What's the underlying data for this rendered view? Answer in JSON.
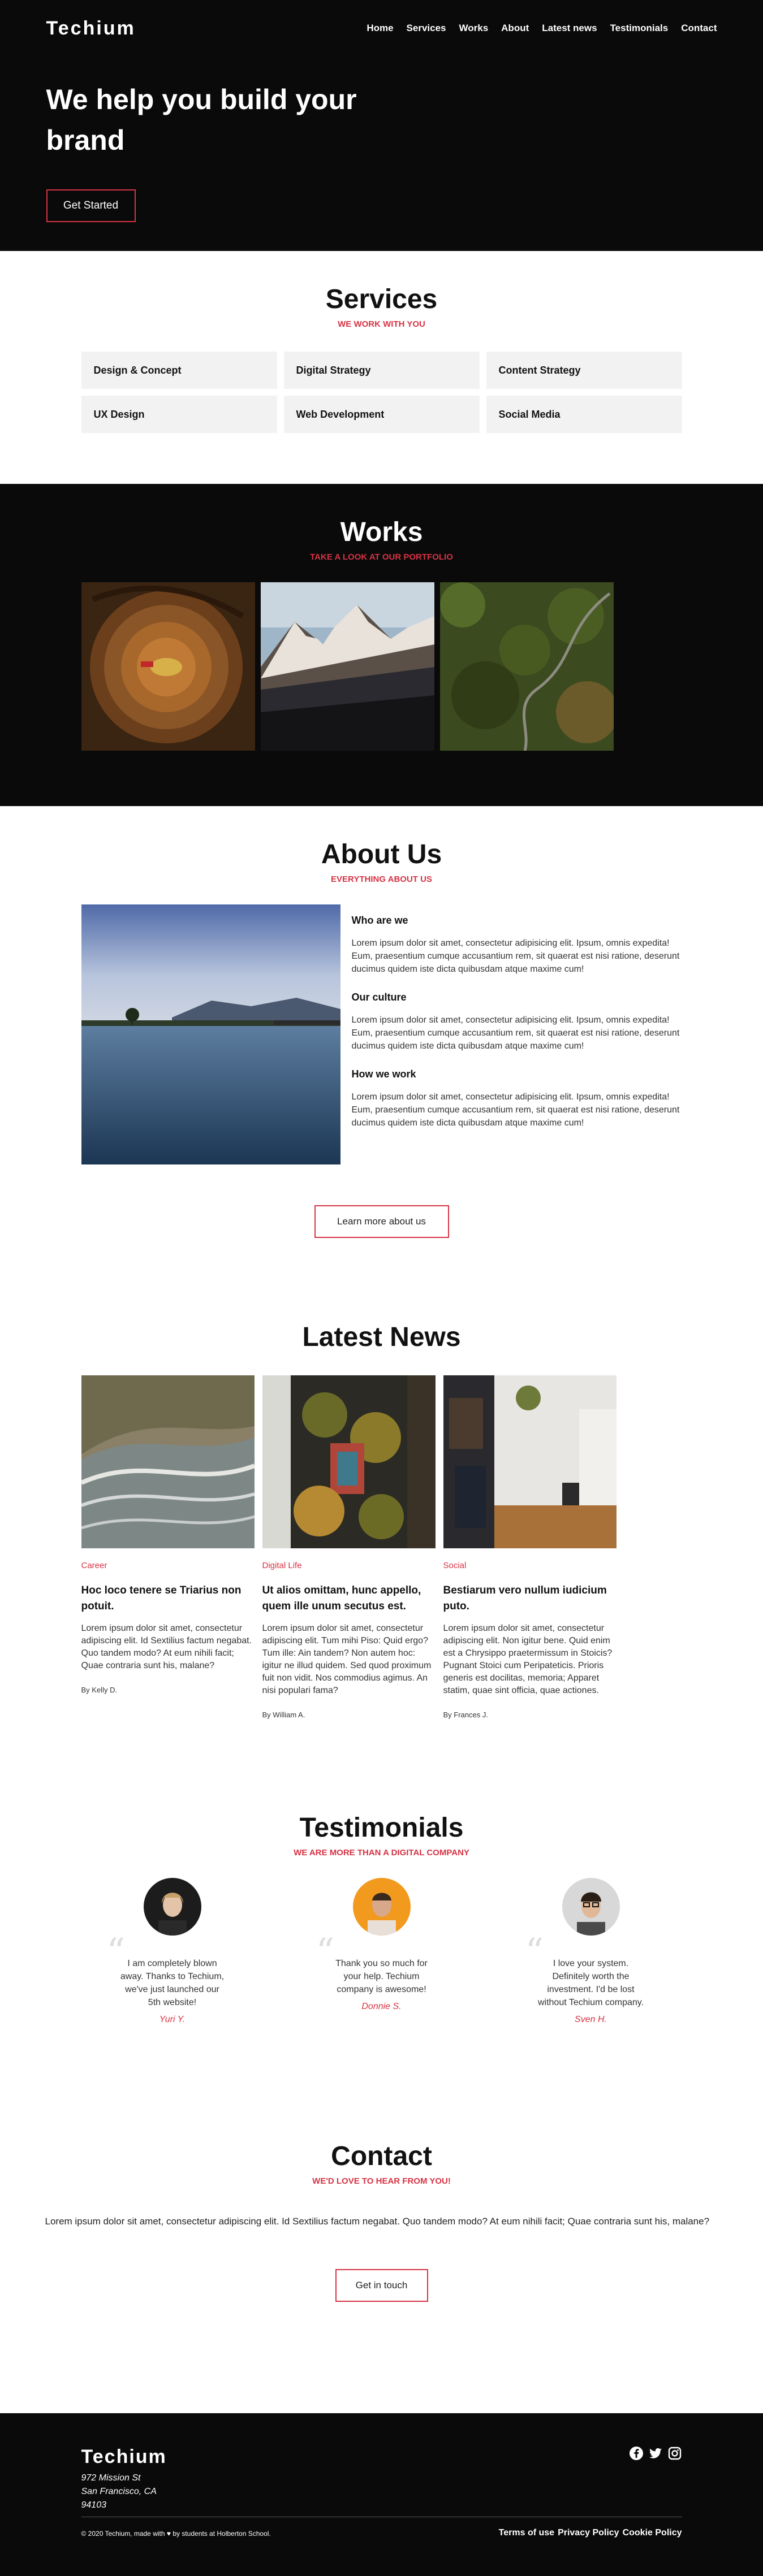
{
  "header": {
    "logo": "Techium",
    "nav": [
      "Home",
      "Services",
      "Works",
      "About",
      "Latest news",
      "Testimonials",
      "Contact"
    ],
    "hero_title": "We help you build your brand",
    "hero_button": "Get Started"
  },
  "services": {
    "title": "Services",
    "subtitle": "WE WORK WITH YOU",
    "items": [
      "Design & Concept",
      "Digital Strategy",
      "Content Strategy",
      "UX Design",
      "Web Development",
      "Social Media"
    ]
  },
  "works": {
    "title": "Works",
    "subtitle": "TAKE A LOOK AT OUR PORTFOLIO"
  },
  "about": {
    "title": "About Us",
    "subtitle": "EVERYTHING ABOUT US",
    "blocks": [
      {
        "heading": "Who are we",
        "text": "Lorem ipsum dolor sit amet, consectetur adipisicing elit. Ipsum, omnis expedita! Eum, praesentium cumque accusantium rem, sit quaerat est nisi ratione, deserunt ducimus quidem iste dicta quibusdam atque maxime cum!"
      },
      {
        "heading": "Our culture",
        "text": "Lorem ipsum dolor sit amet, consectetur adipisicing elit. Ipsum, omnis expedita! Eum, praesentium cumque accusantium rem, sit quaerat est nisi ratione, deserunt ducimus quidem iste dicta quibusdam atque maxime cum!"
      },
      {
        "heading": "How we work",
        "text": "Lorem ipsum dolor sit amet, consectetur adipisicing elit. Ipsum, omnis expedita! Eum, praesentium cumque accusantium rem, sit quaerat est nisi ratione, deserunt ducimus quidem iste dicta quibusdam atque maxime cum!"
      }
    ],
    "button": "Learn more about us"
  },
  "news": {
    "title": "Latest News",
    "items": [
      {
        "category": "Career",
        "title": "Hoc loco tenere se Triarius non potuit.",
        "body": "Lorem ipsum dolor sit amet, consectetur adipiscing elit. Id Sextilius factum negabat. Quo tandem modo? At eum nihili facit; Quae contraria sunt his, malane?",
        "by": "By Kelly D."
      },
      {
        "category": "Digital Life",
        "title": "Ut alios omittam, hunc appello, quem ille unum secutus est.",
        "body": "Lorem ipsum dolor sit amet, consectetur adipiscing elit. Tum mihi Piso: Quid ergo? Tum ille: Ain tandem? Non autem hoc: igitur ne illud quidem. Sed quod proximum fuit non vidit. Nos commodius agimus. An nisi populari fama?",
        "by": "By William A."
      },
      {
        "category": "Social",
        "title": "Bestiarum vero nullum iudicium puto.",
        "body": "Lorem ipsum dolor sit amet, consectetur adipiscing elit. Non igitur bene. Quid enim est a Chrysippo praetermissum in Stoicis? Pugnant Stoici cum Peripateticis. Prioris generis est docilitas, memoria; Apparet statim, quae sint officia, quae actiones.",
        "by": "By Frances J."
      }
    ]
  },
  "testimonials": {
    "title": "Testimonials",
    "subtitle": "WE ARE MORE THAN A DIGITAL COMPANY",
    "items": [
      {
        "quote": "I am completely blown away. Thanks to Techium, we've just launched our 5th website!",
        "name": "Yuri Y."
      },
      {
        "quote": "Thank you so much for your help. Techium company is awesome!",
        "name": "Donnie S."
      },
      {
        "quote": "I love your system. Definitely worth the investment. I'd be lost without Techium company.",
        "name": "Sven H."
      }
    ]
  },
  "contact": {
    "title": "Contact",
    "subtitle": "WE'D LOVE TO HEAR FROM YOU!",
    "text": "Lorem ipsum dolor sit amet, consectetur adipiscing elit. Id Sextilius factum negabat. Quo tandem modo? At eum nihili facit; Quae contraria sunt his, malane?",
    "button": "Get in touch"
  },
  "footer": {
    "logo": "Techium",
    "address": [
      "972 Mission St",
      "San Francisco, CA",
      "94103"
    ],
    "copyright": "© 2020 Techium, made with ♥ by students at Holberton School.",
    "links": [
      "Terms of use",
      "Privacy Policy",
      "Cookie Policy"
    ],
    "social_icons": [
      "facebook-icon",
      "twitter-icon",
      "instagram-icon"
    ]
  },
  "colors": {
    "accent": "#d63344",
    "dark": "#0a0a0a",
    "tile": "#f2f2f2"
  }
}
